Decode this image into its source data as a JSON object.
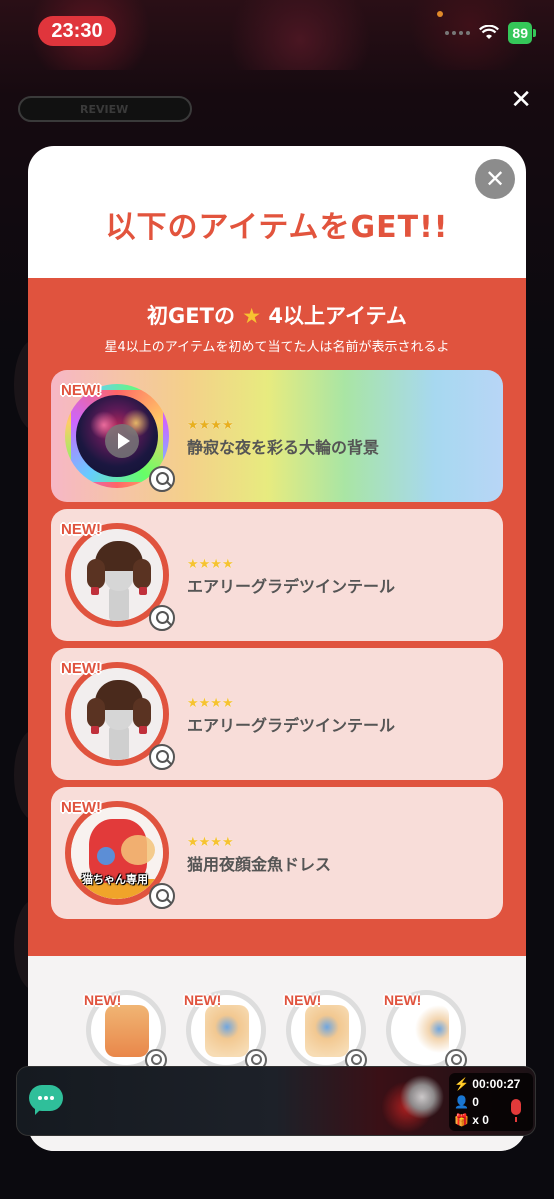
{
  "status_bar": {
    "time": "23:30",
    "battery": "89"
  },
  "background": {
    "pill_text": "REVIEW"
  },
  "modal": {
    "title": "以下のアイテムをGET!!",
    "close_glyph": "✕",
    "section": {
      "title_prefix": "初GETの",
      "title_star": "★",
      "title_suffix": "4以上アイテム",
      "subtitle": "星4以上のアイテムを初めて当てた人は名前が表示されるよ"
    },
    "items": [
      {
        "new_label": "NEW!",
        "rarity": 4,
        "stars_text": "★★★★",
        "name": "静寂な夜を彩る大輪の背景",
        "type": "background"
      },
      {
        "new_label": "NEW!",
        "rarity": 4,
        "stars_text": "★★★★",
        "name": "エアリーグラデツインテール",
        "type": "hair"
      },
      {
        "new_label": "NEW!",
        "rarity": 4,
        "stars_text": "★★★★",
        "name": "エアリーグラデツインテール",
        "type": "hair"
      },
      {
        "new_label": "NEW!",
        "rarity": 4,
        "stars_text": "★★★★",
        "name": "猫用夜顔金魚ドレス",
        "type": "cat-dress",
        "badge": "猫ちゃん専用"
      }
    ],
    "lower_items": [
      {
        "new_label": "NEW!"
      },
      {
        "new_label": "NEW!"
      },
      {
        "new_label": "NEW!"
      },
      {
        "new_label": "NEW!"
      }
    ]
  },
  "bottom_bar": {
    "timer": "00:00:27",
    "listeners": "0",
    "gifts": "x 0"
  },
  "colors": {
    "accent_red": "#e0533e",
    "card_bg": "#f8ddd9",
    "status_time_bg": "#e0353c",
    "battery_green": "#35c759",
    "chat_green": "#2fbf9a"
  },
  "icons": [
    "close-icon",
    "play-icon",
    "zoom-icon",
    "wifi-icon",
    "battery-icon",
    "chat-icon",
    "bolt-icon",
    "person-icon",
    "gift-icon",
    "mic-icon",
    "star-icon"
  ]
}
